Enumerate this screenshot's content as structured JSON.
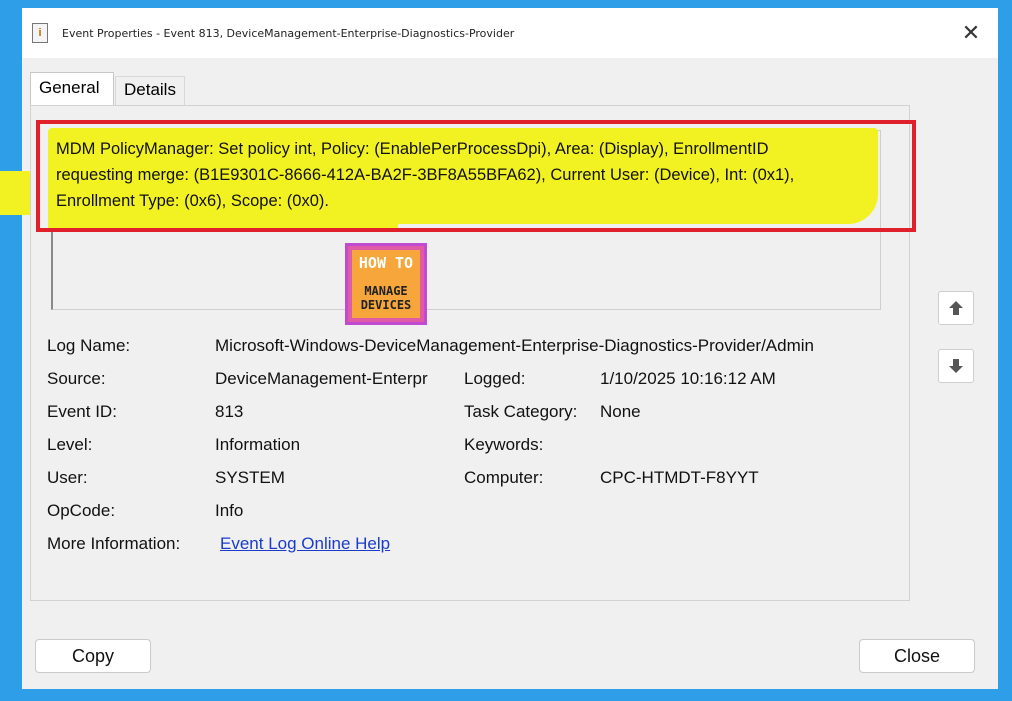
{
  "window": {
    "title": "Event Properties - Event 813, DeviceManagement-Enterprise-Diagnostics-Provider",
    "close_icon": "close-icon"
  },
  "tabs": [
    {
      "label": "General",
      "selected": true
    },
    {
      "label": "Details",
      "selected": false
    }
  ],
  "description": {
    "line1": "MDM PolicyManager: Set policy int, Policy: (EnablePerProcessDpi), Area: (Display), EnrollmentID",
    "line2": "requesting merge: (B1E9301C-8666-412A-BA2F-3BF8A55BFA62), Current User: (Device), Int: (0x1),",
    "line3": "Enrollment Type: (0x6), Scope: (0x0)."
  },
  "watermark": {
    "top": "HOW TO",
    "bottom1": "MANAGE",
    "bottom2": "DEVICES"
  },
  "fields": {
    "log_name_label": "Log Name:",
    "log_name_value": "Microsoft-Windows-DeviceManagement-Enterprise-Diagnostics-Provider/Admin",
    "source_label": "Source:",
    "source_value": "DeviceManagement-Enterpr",
    "logged_label": "Logged:",
    "logged_value": "1/10/2025 10:16:12 AM",
    "event_id_label": "Event ID:",
    "event_id_value": "813",
    "task_category_label": "Task Category:",
    "task_category_value": "None",
    "level_label": "Level:",
    "level_value": "Information",
    "keywords_label": "Keywords:",
    "keywords_value": "",
    "user_label": "User:",
    "user_value": "SYSTEM",
    "computer_label": "Computer:",
    "computer_value": "CPC-HTMDT-F8YYT",
    "opcode_label": "OpCode:",
    "opcode_value": "Info",
    "more_info_label": "More Information:",
    "more_info_link": "Event Log Online Help"
  },
  "buttons": {
    "copy": "Copy",
    "close": "Close",
    "up_icon": "arrow-up-icon",
    "down_icon": "arrow-down-icon"
  },
  "colors": {
    "highlight": "#f2f222",
    "annotation_border": "#e0202a",
    "link": "#1a3cc8",
    "frame": "#2f9ee8"
  }
}
